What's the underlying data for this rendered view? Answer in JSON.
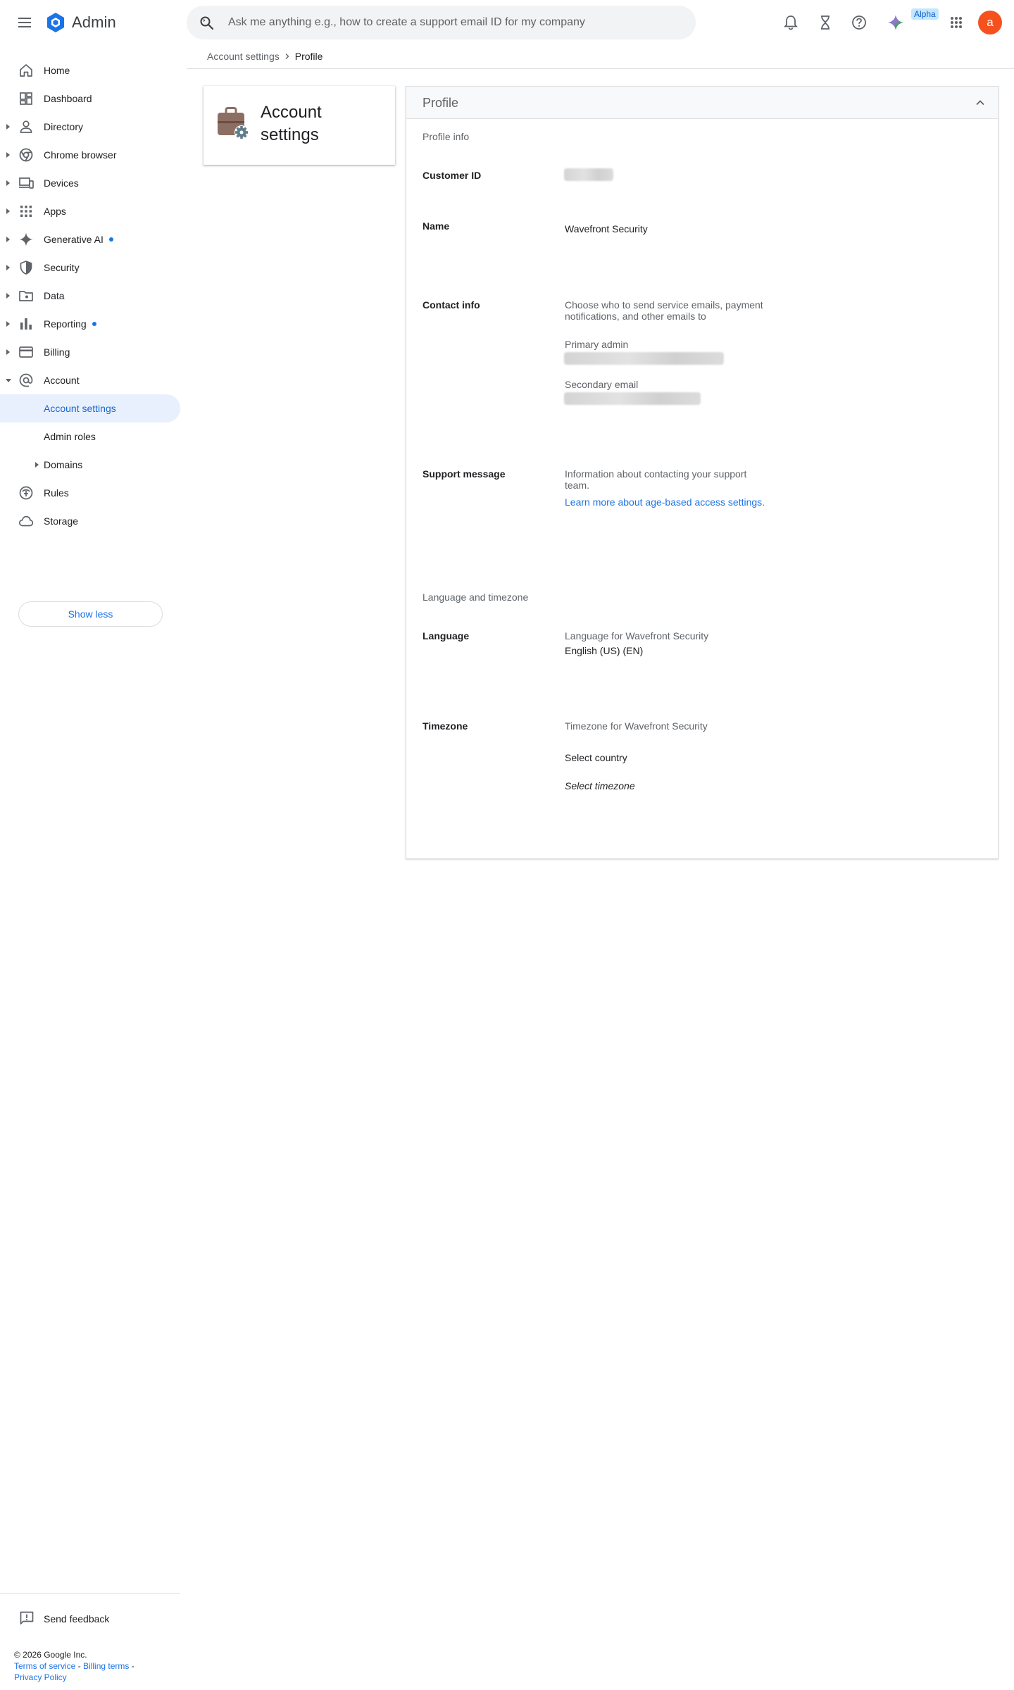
{
  "app": {
    "title": "Admin"
  },
  "search": {
    "placeholder": "Ask me anything e.g., how to create a support email ID for my company"
  },
  "topbar": {
    "alpha_badge": "Alpha",
    "avatar_initial": "a"
  },
  "sidebar": {
    "items": [
      {
        "label": "Home",
        "icon": "home-icon",
        "has_arrow": false,
        "dot": false
      },
      {
        "label": "Dashboard",
        "icon": "dashboard-icon",
        "has_arrow": false,
        "dot": false
      },
      {
        "label": "Directory",
        "icon": "person-icon",
        "has_arrow": true,
        "dot": false
      },
      {
        "label": "Chrome browser",
        "icon": "chrome-icon",
        "has_arrow": true,
        "dot": false
      },
      {
        "label": "Devices",
        "icon": "devices-icon",
        "has_arrow": true,
        "dot": false
      },
      {
        "label": "Apps",
        "icon": "apps-grid-icon",
        "has_arrow": true,
        "dot": false
      },
      {
        "label": "Generative AI",
        "icon": "sparkle-icon",
        "has_arrow": true,
        "dot": true
      },
      {
        "label": "Security",
        "icon": "shield-icon",
        "has_arrow": true,
        "dot": false
      },
      {
        "label": "Data",
        "icon": "folder-icon",
        "has_arrow": true,
        "dot": false
      },
      {
        "label": "Reporting",
        "icon": "bar-chart-icon",
        "has_arrow": true,
        "dot": true
      },
      {
        "label": "Billing",
        "icon": "credit-card-icon",
        "has_arrow": true,
        "dot": false
      },
      {
        "label": "Account",
        "icon": "at-sign-icon",
        "has_arrow": true,
        "expanded": true,
        "dot": false
      }
    ],
    "account_sub": [
      {
        "label": "Account settings",
        "active": true
      },
      {
        "label": "Admin roles",
        "active": false
      },
      {
        "label": "Domains",
        "active": false
      }
    ],
    "more_items": [
      {
        "label": "Rules",
        "icon": "rules-icon"
      },
      {
        "label": "Storage",
        "icon": "cloud-icon"
      }
    ],
    "show_less": "Show less",
    "send_feedback": "Send feedback",
    "footer": {
      "copyright": "© 2026 Google Inc.",
      "terms": "Terms of service",
      "billing_terms": "Billing terms",
      "privacy": "Privacy Policy",
      "sep": " - "
    }
  },
  "breadcrumb": {
    "parent": "Account settings",
    "current": "Profile"
  },
  "account_card": {
    "title": "Account settings",
    "icon": "briefcase-gear-icon"
  },
  "profile": {
    "title": "Profile",
    "section_profile_info": "Profile info",
    "customer_id_label": "Customer ID",
    "name_label": "Name",
    "name_value": "Wavefront Security",
    "contact_label": "Contact info",
    "contact_desc_1": "Choose who to send service emails, payment",
    "contact_desc_2": "notifications, and other emails to",
    "primary_admin_label": "Primary admin",
    "secondary_email_label": "Secondary email",
    "support_label": "Support message",
    "support_desc_1": "Information about contacting your support",
    "support_desc_2": "team.",
    "support_link": "Learn more about age-based access settings.",
    "section_lang_tz": "Language and timezone",
    "language_label": "Language",
    "language_desc": "Language for Wavefront Security",
    "language_value": "English (US) (EN)",
    "timezone_label": "Timezone",
    "timezone_desc": "Timezone for Wavefront Security",
    "timezone_country": "Select country",
    "timezone_zone": "Select timezone"
  },
  "colors": {
    "accent": "#1a73e8",
    "avatar": "#f4511e",
    "active_bg": "#e8f0fe"
  }
}
